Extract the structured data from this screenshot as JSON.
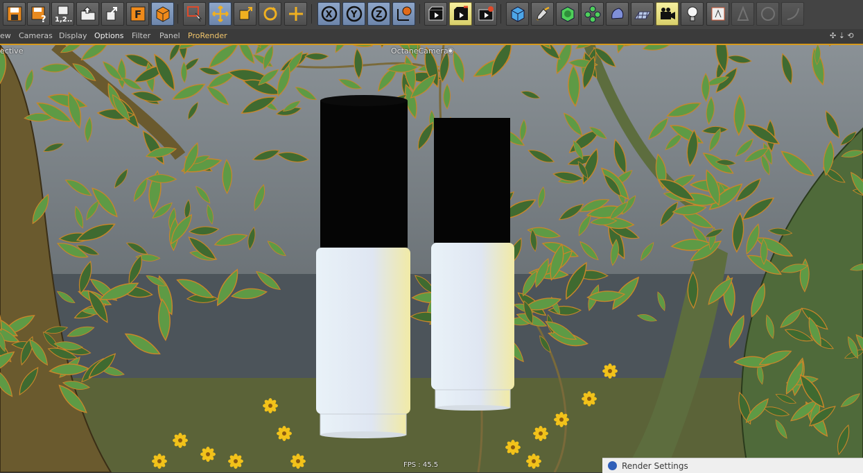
{
  "menubar": {
    "items": [
      {
        "label": "ew"
      },
      {
        "label": "Cameras"
      },
      {
        "label": "Display"
      },
      {
        "label": "Options"
      },
      {
        "label": "Filter"
      },
      {
        "label": "Panel"
      },
      {
        "label": "ProRender"
      }
    ],
    "nav_controls": "✣ ⇣ ⟲"
  },
  "toolbar": {
    "save_version_label": "1,2...",
    "f_label": "F",
    "x_label": "X",
    "y_label": "Y",
    "z_label": "Z"
  },
  "viewport": {
    "mode_label": "ective",
    "camera_name": "OctaneCamera",
    "fps_text": "FPS : 45.5"
  },
  "render_settings": {
    "label": "Render Settings"
  },
  "colors": {
    "highlight": "#d79a1c",
    "leaf": "#5e9a45",
    "leaf_dark": "#3f6a30",
    "outline": "#c9862a"
  }
}
